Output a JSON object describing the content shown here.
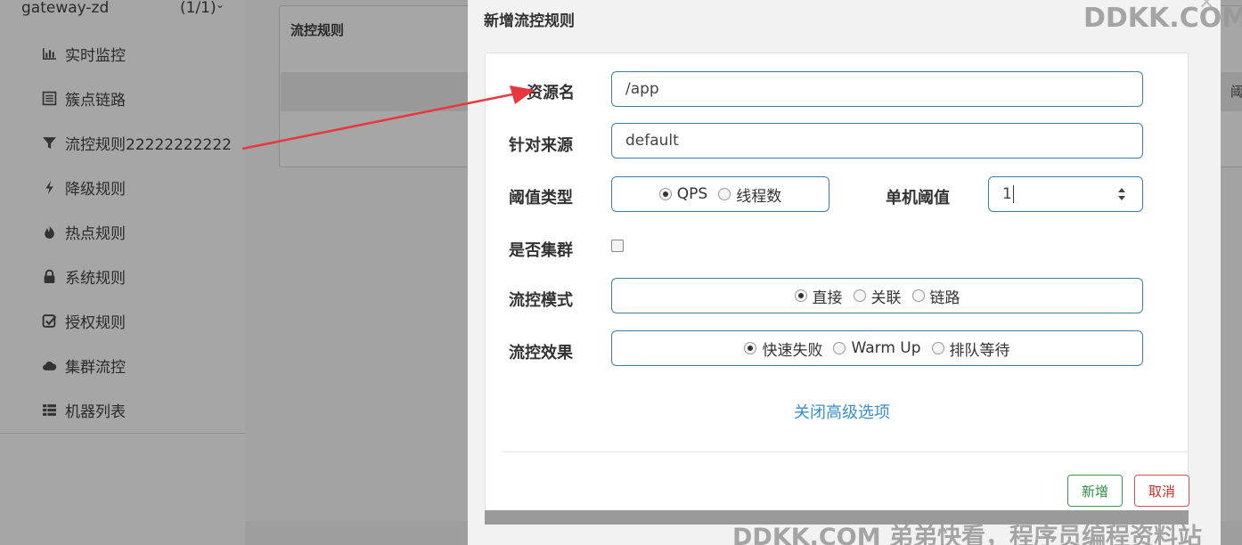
{
  "sidebar": {
    "app_name": "gateway-zd",
    "app_count": "(1/1)",
    "items": [
      {
        "label": "实时监控",
        "icon": "bar-chart-icon"
      },
      {
        "label": "簇点链路",
        "icon": "list-alt-icon"
      },
      {
        "label": "流控规则22222222222",
        "icon": "filter-icon"
      },
      {
        "label": "降级规则",
        "icon": "flash-icon"
      },
      {
        "label": "热点规则",
        "icon": "fire-icon"
      },
      {
        "label": "系统规则",
        "icon": "lock-icon"
      },
      {
        "label": "授权规则",
        "icon": "check-square-icon"
      },
      {
        "label": "集群流控",
        "icon": "cloud-icon"
      },
      {
        "label": "机器列表",
        "icon": "table-list-icon"
      }
    ]
  },
  "main": {
    "panel_title": "流控规则",
    "right_fragment": "阈"
  },
  "modal": {
    "title": "新增流控规则",
    "resource": {
      "label": "资源名",
      "value": "/app"
    },
    "limit_app": {
      "label": "针对来源",
      "value": "default"
    },
    "grade": {
      "label": "阈值类型",
      "options": [
        "QPS",
        "线程数"
      ],
      "selected": 0
    },
    "threshold": {
      "label": "单机阈值",
      "value": "1"
    },
    "cluster": {
      "label": "是否集群",
      "checked": false
    },
    "strategy": {
      "label": "流控模式",
      "options": [
        "直接",
        "关联",
        "链路"
      ],
      "selected": 0
    },
    "behavior": {
      "label": "流控效果",
      "options": [
        "快速失败",
        "Warm Up",
        "排队等待"
      ],
      "selected": 0
    },
    "advanced_link": "关闭高级选项",
    "add_button": "新增",
    "cancel_button": "取消"
  },
  "watermark": {
    "top": "DDKK.COM",
    "bottom": "DDKK.COM 弟弟快看，程序员编程资料站"
  },
  "colors": {
    "field_border": "#3d7ea6",
    "link": "#3a8fc7",
    "add_green": "#2e8b45",
    "cancel_red": "#c9302c",
    "arrow_red": "#e8383d"
  }
}
